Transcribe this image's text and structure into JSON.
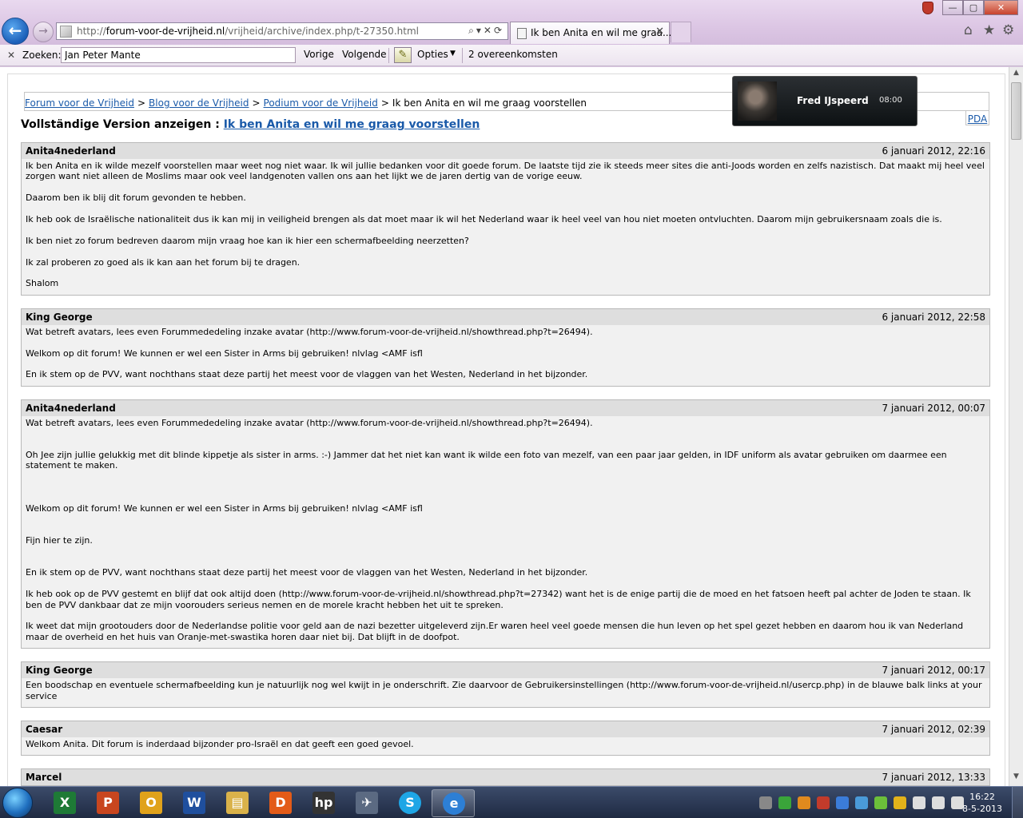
{
  "browser": {
    "url_prefix": "http://",
    "url_host": "forum-voor-de-vrijheid.nl",
    "url_path": "/vrijheid/archive/index.php/t-27350.html",
    "tab_title": "Ik ben Anita en wil me graa...",
    "tab_close": "✕",
    "back_glyph": "←",
    "forward_glyph": "→",
    "address_tools": "⌕▾✕⟳",
    "home_glyph": "⌂",
    "favorites_glyph": "★",
    "settings_glyph": "⚙",
    "window_controls": {
      "minimize": "—",
      "maximize": "▢",
      "close": "✕"
    }
  },
  "findbar": {
    "close": "✕",
    "label": "Zoeken:",
    "value": "Jan Peter Mante",
    "prev_label": "Vorige",
    "next_label": "Volgende",
    "options_label": "Opties",
    "options_arrow": "▼",
    "match_count": "2 overeenkomsten",
    "pencil_glyph": "✎"
  },
  "breadcrumb": [
    {
      "label": "Forum voor de Vrijheid"
    },
    {
      "label": "Blog voor de Vrijheid"
    },
    {
      "label": "Podium voor de Vrijheid"
    }
  ],
  "breadcrumb_current": "Ik ben Anita en wil me graag voorstellen",
  "breadcrumb_separator": ">",
  "heading": {
    "prefix": "Vollständige Version anzeigen :",
    "link": "Ik ben Anita en wil me graag voorstellen"
  },
  "pda_label": "PDA",
  "popup": {
    "name": "Fred IJspeerd",
    "time": "08:00"
  },
  "posts": [
    {
      "author": "Anita4nederland",
      "date": "6 januari 2012, 22:16",
      "paragraphs": [
        "Ik ben Anita en ik wilde mezelf voorstellen maar weet nog niet waar. Ik wil jullie bedanken voor dit goede forum. De laatste tijd zie ik steeds meer sites die anti-Joods worden en zelfs nazistisch. Dat maakt mij heel veel zorgen want niet alleen de Moslims maar ook veel landgenoten vallen ons aan het lijkt we de jaren dertig van de vorige eeuw.",
        "Daarom ben ik blij dit forum gevonden te hebben.",
        "Ik heb ook de Israëlische nationaliteit dus ik kan mij in veiligheid brengen als dat moet maar ik wil het Nederland waar ik heel veel van hou niet moeten ontvluchten. Daarom mijn gebruikersnaam zoals die is.",
        "Ik ben niet zo forum bedreven daarom mijn vraag hoe kan ik hier een schermafbeelding neerzetten?",
        "Ik zal proberen zo goed als ik kan aan het forum bij te dragen.",
        "Shalom"
      ]
    },
    {
      "author": "King George",
      "date": "6 januari 2012, 22:58",
      "paragraphs": [
        "Wat betreft avatars, lees even Forummededeling inzake avatar (http://www.forum-voor-de-vrijheid.nl/showthread.php?t=26494).",
        "Welkom op dit forum! We kunnen er wel een Sister in Arms bij gebruiken! nlvlag <AMF isfl",
        "En ik stem op de PVV, want nochthans staat deze partij het meest voor de vlaggen van het Westen, Nederland in het bijzonder."
      ]
    },
    {
      "author": "Anita4nederland",
      "date": "7 januari 2012, 00:07",
      "paragraphs": [
        "Wat betreft avatars, lees even Forummededeling inzake avatar (http://www.forum-voor-de-vrijheid.nl/showthread.php?t=26494).",
        "Oh Jee zijn jullie gelukkig met dit blinde kippetje als sister in arms. :-) Jammer dat het niet kan want ik wilde een foto van mezelf, van een paar jaar gelden, in IDF uniform als avatar gebruiken om daarmee een statement te maken.",
        "Welkom op dit forum! We kunnen er wel een Sister in Arms bij gebruiken! nlvlag <AMF isfl",
        "Fijn hier te zijn.",
        "En ik stem op de PVV, want nochthans staat deze partij het meest voor de vlaggen van het Westen, Nederland in het bijzonder.",
        "Ik heb ook op de PVV gestemt en blijf dat ook altijd doen (http://www.forum-voor-de-vrijheid.nl/showthread.php?t=27342) want het is de enige partij die de moed en het fatsoen heeft pal achter de Joden te staan. Ik ben de PVV dankbaar dat ze mijn voorouders serieus nemen en de morele kracht hebben het uit te spreken.",
        "Ik weet dat mijn grootouders door de Nederlandse politie voor geld aan de nazi bezetter uitgeleverd zijn.Er waren heel veel goede mensen die hun leven op het spel gezet hebben en daarom hou ik van Nederland maar de overheid en het huis van Oranje-met-swastika horen daar niet bij. Dat blijft in de doofpot."
      ]
    },
    {
      "author": "King George",
      "date": "7 januari 2012, 00:17",
      "paragraphs": [
        "Een boodschap en eventuele schermafbeelding kun je natuurlijk nog wel kwijt in je onderschrift. Zie daarvoor de Gebruikersinstellingen (http://www.forum-voor-de-vrijheid.nl/usercp.php) in de blauwe balk links at your service"
      ]
    },
    {
      "author": "Caesar",
      "date": "7 januari 2012, 02:39",
      "paragraphs": [
        "Welkom Anita. Dit forum is inderdaad bijzonder pro-Israël en dat geeft een goed gevoel."
      ]
    },
    {
      "author": "Marcel",
      "date": "7 januari 2012, 13:33",
      "paragraphs": []
    }
  ],
  "taskbar": {
    "apps": [
      {
        "name": "excel",
        "glyph": "X",
        "color": "#1e7a36"
      },
      {
        "name": "powerpoint",
        "glyph": "P",
        "color": "#c8461f"
      },
      {
        "name": "outlook",
        "glyph": "O",
        "color": "#e0a21b"
      },
      {
        "name": "word",
        "glyph": "W",
        "color": "#1f4f9e"
      },
      {
        "name": "explorer",
        "glyph": "▤",
        "color": "#d9b24a"
      },
      {
        "name": "daemon",
        "glyph": "D",
        "color": "#e35b18"
      },
      {
        "name": "hp",
        "glyph": "hp",
        "color": "#333333"
      },
      {
        "name": "tools",
        "glyph": "✈",
        "color": "#5b6a82"
      },
      {
        "name": "skype",
        "glyph": "S",
        "color": "#1ea6e6"
      },
      {
        "name": "internet-explorer",
        "glyph": "e",
        "color": "#2d7fd5"
      }
    ],
    "tray_colors": [
      "#888888",
      "#3aa53a",
      "#e08a1e",
      "#c23b2b",
      "#3b7cd9",
      "#4a9ad8",
      "#6cbf3a",
      "#e2b21a",
      "#dddddd",
      "#dddddd",
      "#dddddd"
    ],
    "time": "16:22",
    "date": "8-5-2013"
  }
}
